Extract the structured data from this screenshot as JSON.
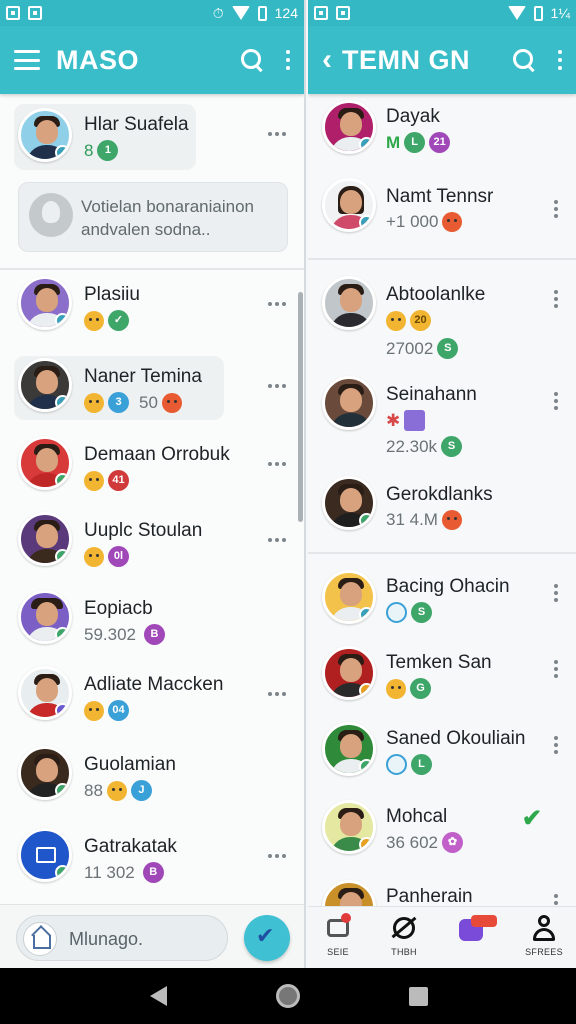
{
  "left_pane": {
    "status": {
      "time": "124"
    },
    "app_bar": {
      "title": "MASO"
    },
    "pinned": {
      "name": "Hlar Suafela",
      "badges": [
        "8",
        "1"
      ]
    },
    "info_card": {
      "text": "Votielan bonaraniainon andvalen sodna.."
    },
    "contacts": [
      {
        "name": "Plasiiu",
        "badges": [
          "",
          ""
        ],
        "color": "#8a6ec9"
      },
      {
        "name": "Naner Temina",
        "sub": "50",
        "badges": [
          "",
          "3"
        ],
        "color": "#3b3a38"
      },
      {
        "name": "Demaan Orrobuk",
        "badges": [
          "",
          "41"
        ],
        "color": "#d83a3a"
      },
      {
        "name": "Uuplc Stoulan",
        "badges": [
          "",
          "0l"
        ],
        "color": "#5a3a7a"
      },
      {
        "name": "Eopiacb",
        "sub": "59.302",
        "badges": [
          "B"
        ],
        "color": "#7b5fc4"
      },
      {
        "name": "Adliate Maccken",
        "badges": [
          "",
          "04"
        ],
        "color": "#e8eef0"
      },
      {
        "name": "Guolamian",
        "sub": "88",
        "badges": [
          "",
          "J"
        ],
        "color": "#3a2a1e"
      },
      {
        "name": "Gatrakatak",
        "sub": "11 302",
        "badges": [
          "B"
        ],
        "color": "#1f56c9"
      }
    ],
    "composer": {
      "placeholder": "Mlunago."
    }
  },
  "right_pane": {
    "status": {
      "time": "1¼"
    },
    "app_bar": {
      "title": "TEMN GN"
    },
    "contacts": [
      {
        "name": "Dayak",
        "sub": "M",
        "badges": [
          "L",
          "21"
        ],
        "color": "#b0206a"
      },
      {
        "name": "Namt Tennsr",
        "sub": "+1 000",
        "badges": [],
        "color": "#2a1d16"
      },
      {
        "name": "Abtoolanlke",
        "sub": "27002",
        "badges": [
          "20",
          "S"
        ],
        "color": "#c0c6c9"
      },
      {
        "name": "Seinahann",
        "sub": "22.30k",
        "badges": [
          "",
          "S"
        ],
        "color": "#6a4a3a"
      },
      {
        "name": "Gerokdlanks",
        "sub": "31 4.M",
        "badges": [],
        "color": "#3a2a20"
      },
      {
        "name": "Bacing Ohacin",
        "badges": [
          "",
          "S"
        ],
        "color": "#f2c24a"
      },
      {
        "name": "Temken San",
        "badges": [
          "",
          "G"
        ],
        "color": "#b02020"
      },
      {
        "name": "Saned Okouliain",
        "badges": [
          "",
          "L"
        ],
        "color": "#2f8a3a"
      },
      {
        "name": "Mohcal",
        "sub": "36 602",
        "badges": [
          ""
        ],
        "color": "#e4e8a0"
      },
      {
        "name": "Panherain",
        "badges": [],
        "color": "#c9902a"
      }
    ],
    "tabs": [
      {
        "label": "SEIE",
        "icon": "chat-bubble-icon"
      },
      {
        "label": "THBH",
        "icon": "satellite-icon"
      },
      {
        "label": "",
        "icon": "messages-icon"
      },
      {
        "label": "SFREES",
        "icon": "profile-icon"
      }
    ]
  }
}
